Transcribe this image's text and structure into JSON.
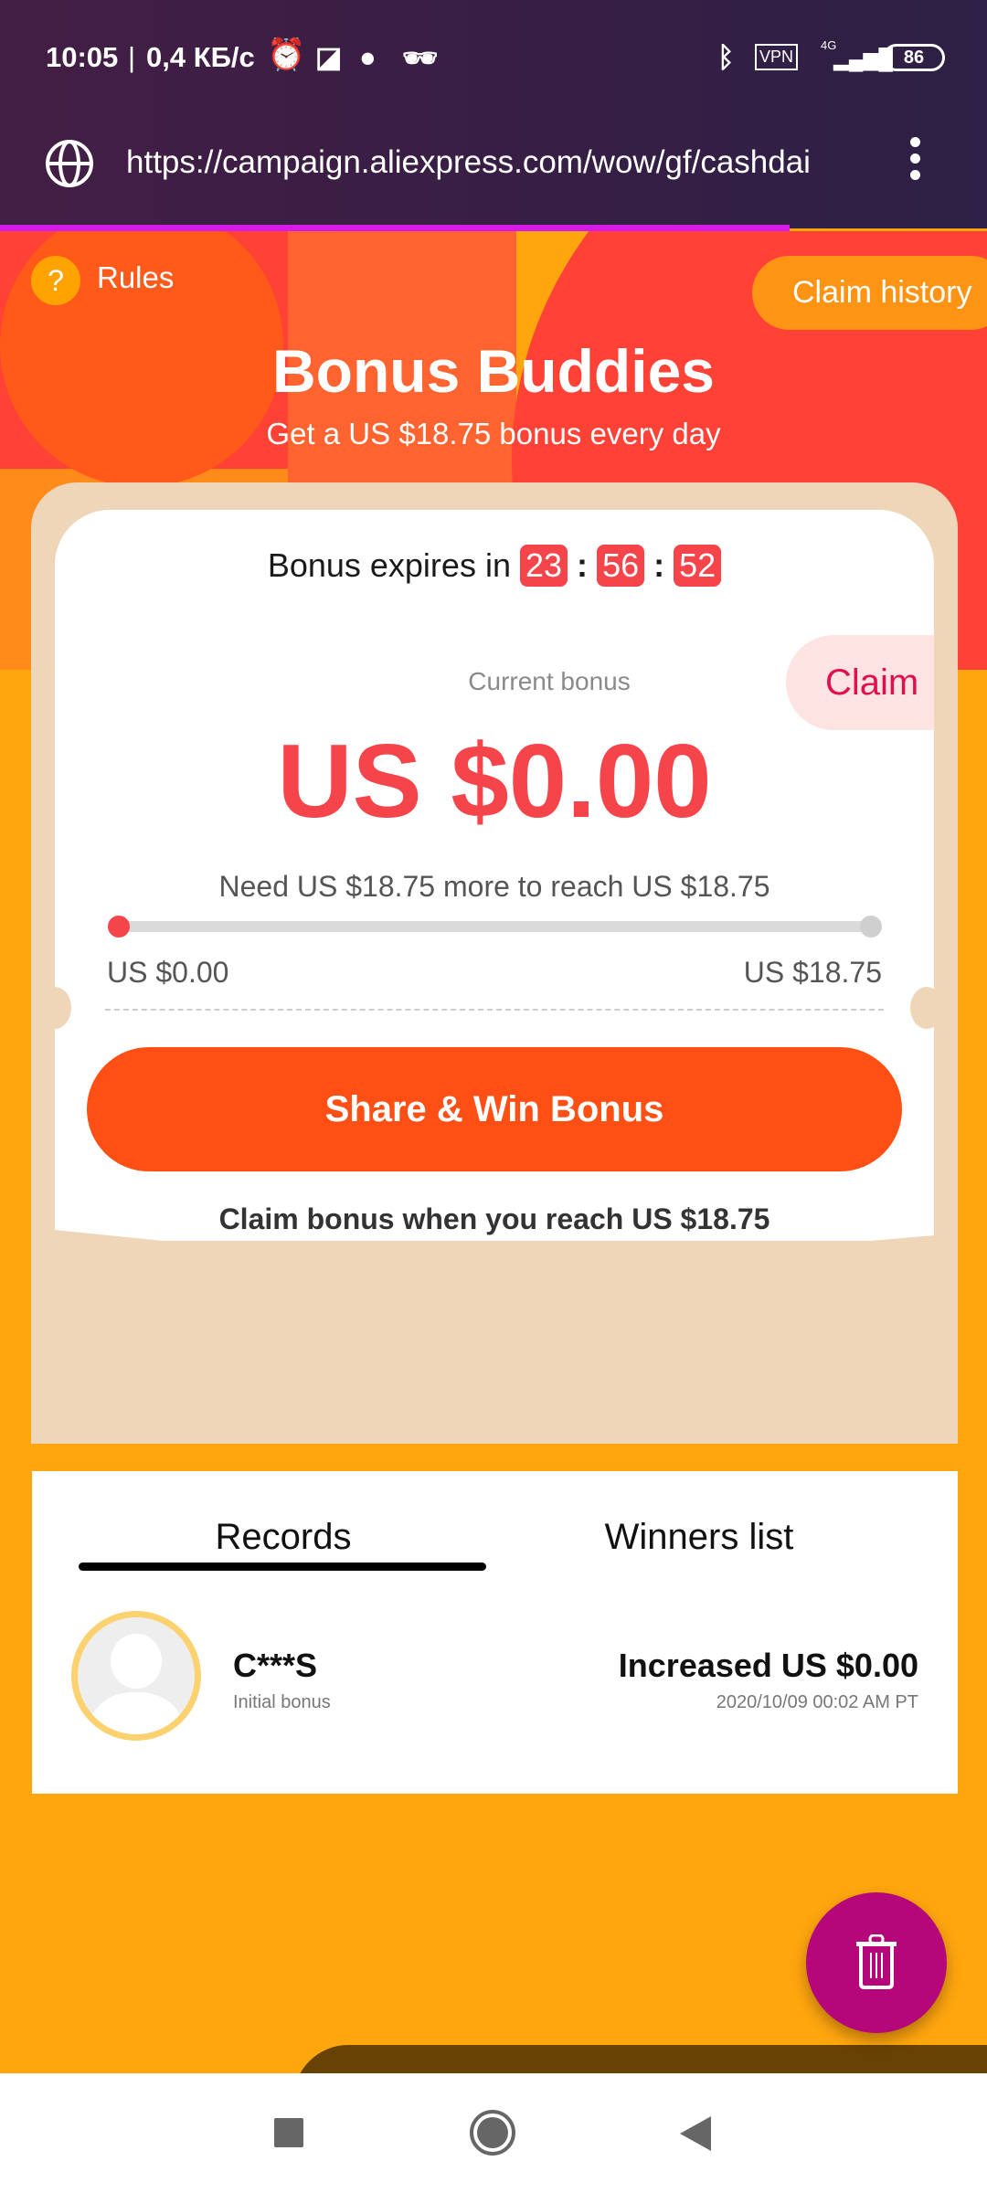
{
  "status_bar": {
    "time": "10:05",
    "speed": "0,4 КБ/с",
    "vpn": "VPN",
    "network": "4G",
    "battery": "86",
    "icons": [
      "alarm-icon",
      "notification-icon",
      "firefox-icon",
      "incognito-icon",
      "bluetooth-icon",
      "signal-icon",
      "battery-icon"
    ]
  },
  "browser": {
    "url": "https://campaign.aliexpress.com/wow/gf/cashdai",
    "page_load_progress": 0.8
  },
  "header": {
    "rules": "Rules",
    "rules_icon": "?",
    "claim_history": "Claim history",
    "title": "Bonus Buddies",
    "subtitle": "Get a US $18.75 bonus every day"
  },
  "card": {
    "expires_label": "Bonus expires in",
    "timer": {
      "h": "23",
      "m": "56",
      "s": "52",
      "sep": ":"
    },
    "claim": "Claim",
    "current_label": "Current bonus",
    "current_value": "US $0.00",
    "need_text": "Need US $18.75 more to reach US $18.75",
    "progress_min": "US $0.00",
    "progress_max": "US $18.75",
    "progress_fraction": 0,
    "share_button": "Share & Win Bonus",
    "claim_note": "Claim bonus when you reach US $18.75"
  },
  "records": {
    "tabs": [
      {
        "label": "Records",
        "active": true
      },
      {
        "label": "Winners list",
        "active": false
      }
    ],
    "items": [
      {
        "name": "C***S",
        "desc": "Initial bonus",
        "amount": "Increased US $0.00",
        "time": "2020/10/09 00:02 AM PT"
      }
    ]
  },
  "colors": {
    "accent": "#ff4f14",
    "red": "#f5444a",
    "background": "#ffa60f",
    "fab": "#b5067a"
  }
}
